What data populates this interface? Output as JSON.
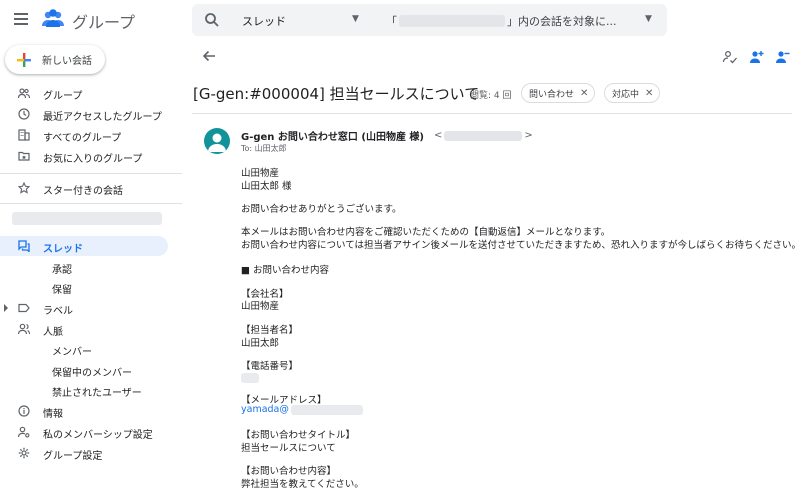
{
  "app": {
    "title": "グループ"
  },
  "search": {
    "scope": "スレッド",
    "prefix": "「",
    "suffix": "」内の会話を対象に..."
  },
  "sidebar": {
    "new_conversation": "新しい会話",
    "items": {
      "groups": "グループ",
      "recent": "最近アクセスしたグループ",
      "all": "すべてのグループ",
      "favorites": "お気に入りのグループ",
      "starred": "スター付きの会話",
      "threads": "スレッド",
      "approval": "承認",
      "hold": "保留",
      "labels": "ラベル",
      "people": "人脈",
      "members": "メンバー",
      "pending_members": "保留中のメンバー",
      "banned_users": "禁止されたユーザー",
      "info": "情報",
      "membership_settings": "私のメンバーシップ設定",
      "group_settings": "グループ設定"
    }
  },
  "thread": {
    "subject": "[G-gen:#000004] 担当セールスについて",
    "views": "閲覧: 4 回",
    "chips": [
      "問い合わせ",
      "対応中"
    ]
  },
  "message": {
    "sender": "G-gen お問い合わせ窓口 (山田物産 様)",
    "addr_open": "<",
    "addr_close": ">",
    "to": "To: 山田太郎",
    "lines": [
      "山田物産",
      "山田太郎 様",
      "お問い合わせありがとうございます。",
      "本メールはお問い合わせ内容をご確認いただくための【自動返信】メールとなります。",
      "お問い合わせ内容については担当者アサイン後メールを送付させていただきますため、恐れ入りますが今しばらくお待ちください。",
      "■ お問い合わせ内容",
      "【会社名】",
      "山田物産",
      "【担当者名】",
      "山田太郎",
      "【電話番号】",
      "【メールアドレス】",
      "yamada@",
      "【お問い合わせタイトル】",
      "担当セールスについて",
      "【お問い合わせ内容】",
      "弊社担当を教えてください。"
    ]
  },
  "colors": {
    "accent": "#1a73e8",
    "avatar": "#12939a",
    "active_bg": "#e8f0fe"
  },
  "icons": [
    "menu-icon",
    "groups-logo-icon",
    "search-icon",
    "plus-icon",
    "back-arrow-icon",
    "assign-icon",
    "add-person-icon",
    "remove-person-icon"
  ]
}
